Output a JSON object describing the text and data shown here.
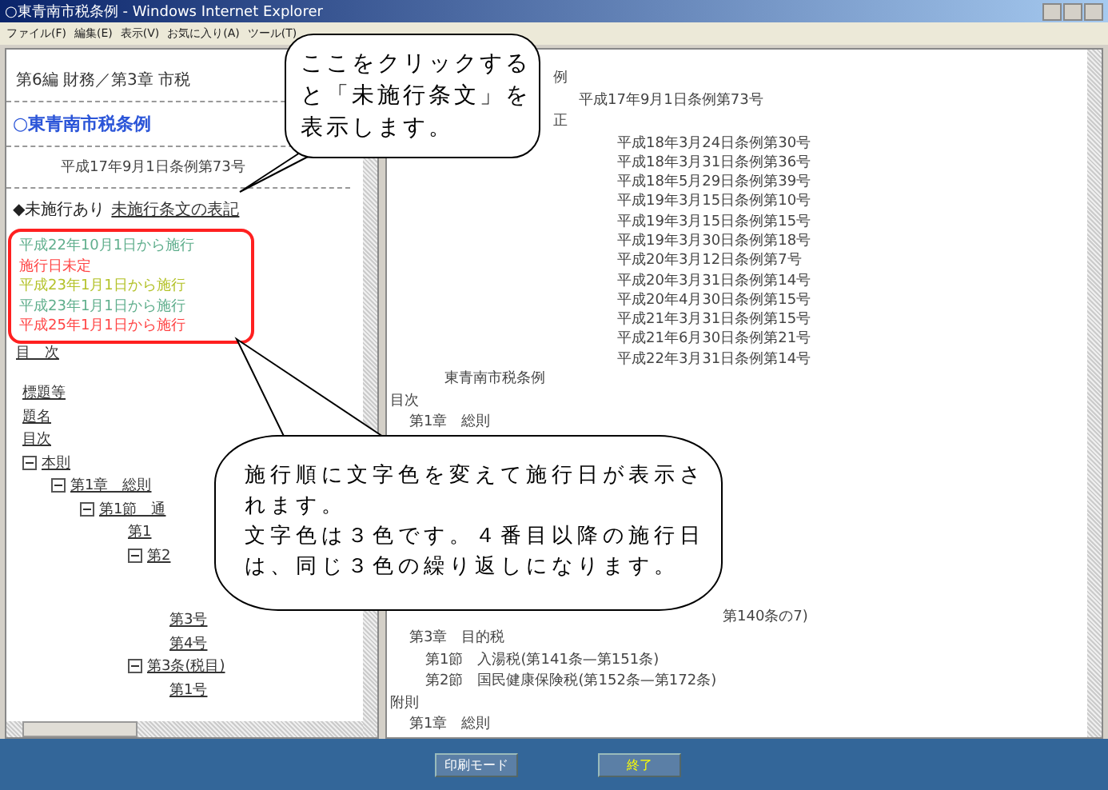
{
  "window": {
    "title": "○東青南市税条例 - Windows Internet Explorer"
  },
  "menu": [
    "ファイル(F)",
    "編集(E)",
    "表示(V)",
    "お気に入り(A)",
    "ツール(T)"
  ],
  "left_pane": {
    "breadcrumb": "第6編 財務／第3章 市税",
    "title": "○東青南市税条例",
    "enacted": "平成17年9月1日条例第73号",
    "notice": "◆未施行あり",
    "notice_link": "未施行条文の表記",
    "enforcement_dates": [
      {
        "text": "平成22年10月1日から施行",
        "color": "#5fae8c"
      },
      {
        "text": "施行日未定",
        "color": "#ff4444"
      },
      {
        "text": "平成23年1月1日から施行",
        "color": "#b4c22a"
      },
      {
        "text": "平成23年1月1日から施行",
        "color": "#5fae8c"
      },
      {
        "text": "平成25年1月1日から施行",
        "color": "#ff4444"
      }
    ],
    "toc_heading": "目　次",
    "tree": [
      {
        "label": "標題等"
      },
      {
        "label": "題名"
      },
      {
        "label": "目次"
      },
      {
        "label": "本則",
        "expanded": true,
        "children": [
          {
            "label": "第1章　総則",
            "expanded": true,
            "children": [
              {
                "label": "第1節　通",
                "expanded": true,
                "children": [
                  {
                    "label": "第1"
                  },
                  {
                    "label": "第2",
                    "expanded": true,
                    "children": [
                      {
                        "label": "第3号"
                      },
                      {
                        "label": "第4号"
                      }
                    ]
                  },
                  {
                    "label": "第3条(税目)",
                    "expanded": true,
                    "children": [
                      {
                        "label": "第1号"
                      }
                    ]
                  }
                ]
              }
            ]
          }
        ]
      }
    ]
  },
  "right_pane": {
    "top_lines": [
      {
        "text": "例",
        "kind": "fragment"
      },
      {
        "text": "平成17年9月1日条例第73号",
        "kind": "date"
      },
      {
        "text": "正",
        "kind": "fragment"
      },
      {
        "text": "平成18年3月24日条例第30号",
        "kind": "amendment"
      },
      {
        "text": "平成18年3月31日条例第36号",
        "kind": "amendment"
      },
      {
        "text": "平成18年5月29日条例第39号",
        "kind": "amendment"
      },
      {
        "text": "平成19年3月15日条例第10号",
        "kind": "amendment"
      },
      {
        "text": "平成19年3月15日条例第15号",
        "kind": "amendment"
      },
      {
        "text": "平成19年3月30日条例第18号",
        "kind": "amendment"
      },
      {
        "text": "平成20年3月12日条例第7号",
        "kind": "amendment"
      },
      {
        "text": "平成20年3月31日条例第14号",
        "kind": "amendment"
      },
      {
        "text": "平成20年4月30日条例第15号",
        "kind": "amendment"
      },
      {
        "text": "平成21年3月31日条例第15号",
        "kind": "amendment"
      },
      {
        "text": "平成21年6月30日条例第21号",
        "kind": "amendment"
      },
      {
        "text": "平成22年3月31日条例第14号",
        "kind": "amendment"
      },
      {
        "text": "東青南市税条例",
        "kind": "title"
      },
      {
        "text": "目次",
        "kind": "main"
      },
      {
        "text": "第1章　総則",
        "kind": "chapter"
      }
    ],
    "bottom_lines": [
      {
        "text": "第140条の7)",
        "kind": "tail"
      },
      {
        "text": "第3章　目的税",
        "kind": "chapter"
      },
      {
        "text": "第1節　入湯税(第141条—第151条)",
        "kind": "section"
      },
      {
        "text": "第2節　国民健康保険税(第152条—第172条)",
        "kind": "section"
      },
      {
        "text": "附則",
        "kind": "main"
      },
      {
        "text": "第1章　総則",
        "kind": "chapter"
      }
    ]
  },
  "buttons": [
    "印刷モード",
    "終了"
  ],
  "callouts": [
    {
      "text": "ここをクリックすると「未施行条文」を表示します。"
    },
    {
      "paragraphs": [
        "施行順に文字色を変えて施行日が表示されます。",
        "文字色は３色です。４番目以降の施行日は、同じ３色の繰り返しになります。"
      ]
    }
  ]
}
